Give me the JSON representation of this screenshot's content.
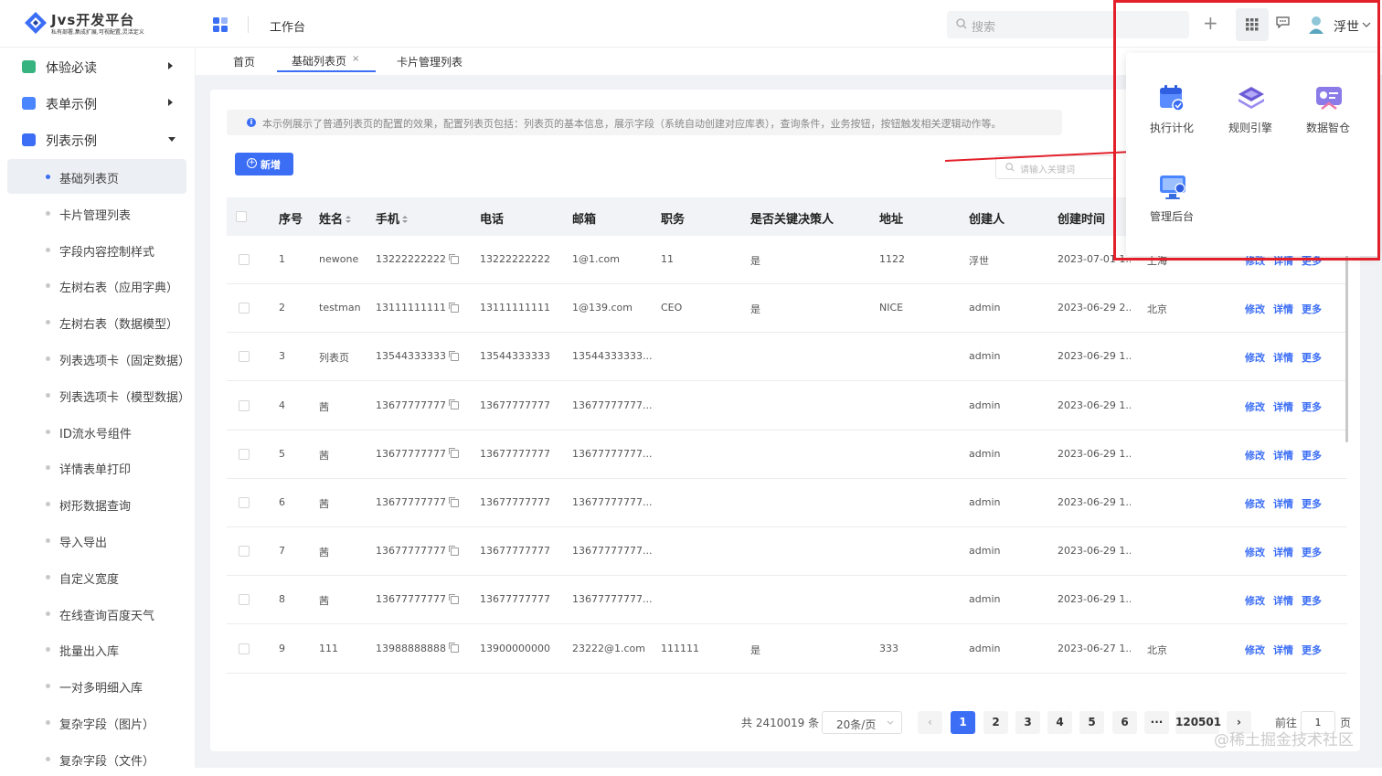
{
  "app": {
    "logo_name": "Jvs开发平台",
    "logo_slogan": "私有部署,集成扩展,可视配置,灵活定义",
    "top_title": "工作台",
    "search_placeholder": "搜索",
    "user_name": "浮世"
  },
  "sidebar": {
    "groups": [
      {
        "label": "体验必读",
        "icon": "experience-icon"
      },
      {
        "label": "表单示例",
        "icon": "form-icon"
      },
      {
        "label": "列表示例",
        "icon": "list-icon"
      }
    ],
    "items": [
      "基础列表页",
      "卡片管理列表",
      "字段内容控制样式",
      "左树右表（应用字典）",
      "左树右表（数据模型）",
      "列表选项卡（固定数据）",
      "列表选项卡（模型数据）",
      "ID流水号组件",
      "详情表单打印",
      "树形数据查询",
      "导入导出",
      "自定义宽度",
      "在线查询百度天气",
      "批量出入库",
      "一对多明细入库",
      "复杂字段（图片）",
      "复杂字段（文件）"
    ]
  },
  "tabs": [
    "首页",
    "基础列表页",
    "卡片管理列表"
  ],
  "notice": "本示例展示了普通列表页的配置的效果，配置列表页包括：列表页的基本信息，展示字段（系统自动创建对应库表），查询条件，业务按钮，按钮触发相关逻辑动作等。",
  "add_button": "新增",
  "keyword_placeholder": "请输入关键词",
  "table": {
    "columns": [
      "序号",
      "姓名",
      "手机",
      "电话",
      "邮箱",
      "职务",
      "是否关键决策人",
      "地址",
      "创建人",
      "创建时间"
    ],
    "rows": [
      [
        "1",
        "newone",
        "13222222222",
        "13222222222",
        "1@1.com",
        "11",
        "是",
        "1122",
        "浮世",
        "2023-07-01 1...",
        "上海"
      ],
      [
        "2",
        "testman",
        "13111111111",
        "13111111111",
        "1@139.com",
        "CEO",
        "是",
        "NICE",
        "admin",
        "2023-06-29 2...",
        "北京"
      ],
      [
        "3",
        "列表页",
        "13544333333",
        "13544333333",
        "13544333333...",
        "",
        "",
        "",
        "admin",
        "2023-06-29 1...",
        ""
      ],
      [
        "4",
        "茜",
        "13677777777",
        "13677777777",
        "13677777777...",
        "",
        "",
        "",
        "admin",
        "2023-06-29 1...",
        ""
      ],
      [
        "5",
        "茜",
        "13677777777",
        "13677777777",
        "13677777777...",
        "",
        "",
        "",
        "admin",
        "2023-06-29 1...",
        ""
      ],
      [
        "6",
        "茜",
        "13677777777",
        "13677777777",
        "13677777777...",
        "",
        "",
        "",
        "admin",
        "2023-06-29 1...",
        ""
      ],
      [
        "7",
        "茜",
        "13677777777",
        "13677777777",
        "13677777777...",
        "",
        "",
        "",
        "admin",
        "2023-06-29 1...",
        ""
      ],
      [
        "8",
        "茜",
        "13677777777",
        "13677777777",
        "13677777777...",
        "",
        "",
        "",
        "admin",
        "2023-06-29 1...",
        ""
      ],
      [
        "9",
        "111",
        "13988888888",
        "13900000000",
        "23222@1.com",
        "111111",
        "是",
        "333",
        "admin",
        "2023-06-27 1...",
        "北京"
      ]
    ],
    "actions": [
      "修改",
      "详情",
      "更多"
    ]
  },
  "pagination": {
    "total": "共 2410019 条",
    "page_size": "20条/页",
    "pages": [
      "1",
      "2",
      "3",
      "4",
      "5",
      "6",
      "···"
    ],
    "last_page": "120501",
    "goto_label": "前往",
    "goto_value": "1",
    "page_label": "页"
  },
  "popover": {
    "items": [
      {
        "label": "执行计化",
        "icon": "calendar-check-icon"
      },
      {
        "label": "规则引擎",
        "icon": "layers-icon"
      },
      {
        "label": "数据智仓",
        "icon": "data-warehouse-icon"
      },
      {
        "label": "管理后台",
        "icon": "admin-monitor-icon"
      }
    ]
  },
  "watermark": "@稀土掘金技术社区",
  "colors": {
    "primary": "#3b6ef5",
    "highlight": "#e3202a"
  }
}
